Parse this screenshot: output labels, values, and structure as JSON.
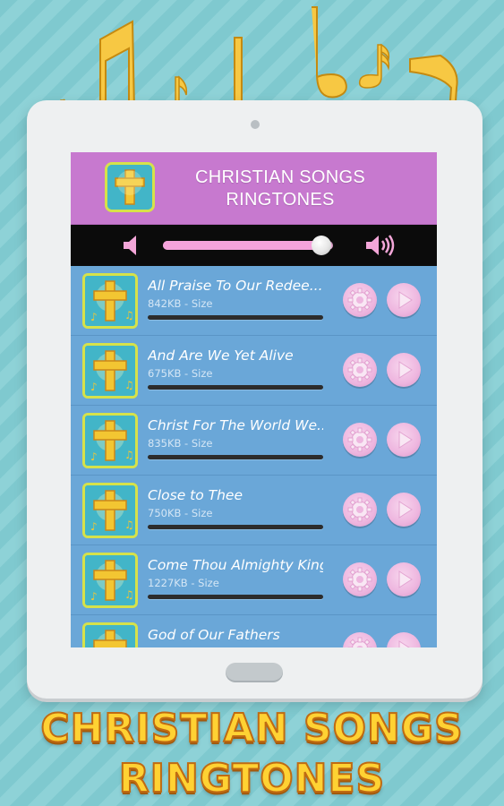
{
  "app": {
    "title_line1": "CHRISTIAN SONGS",
    "title_line2": "RINGTONES"
  },
  "volume": {
    "level": 0.93
  },
  "songs": [
    {
      "title": "All Praise To Our Redee...",
      "size": "842KB - Size"
    },
    {
      "title": "And Are We Yet Alive",
      "size": "675KB - Size"
    },
    {
      "title": "Christ For The World We...",
      "size": "835KB - Size"
    },
    {
      "title": "Close to Thee",
      "size": "750KB - Size"
    },
    {
      "title": "Come Thou Almighty King",
      "size": "1227KB - Size"
    },
    {
      "title": "God of Our Fathers",
      "size": ""
    }
  ],
  "banner": {
    "line1": "CHRISTIAN SONGS",
    "line2": "RINGTONES"
  },
  "colors": {
    "header": "#c779cf",
    "list_bg": "#6aa7d8",
    "banner_text": "#ffd233",
    "note": "#f7c843"
  },
  "icons": [
    "music-note-icon",
    "cross-icon",
    "speaker-low-icon",
    "speaker-high-icon",
    "gear-icon",
    "play-icon"
  ]
}
